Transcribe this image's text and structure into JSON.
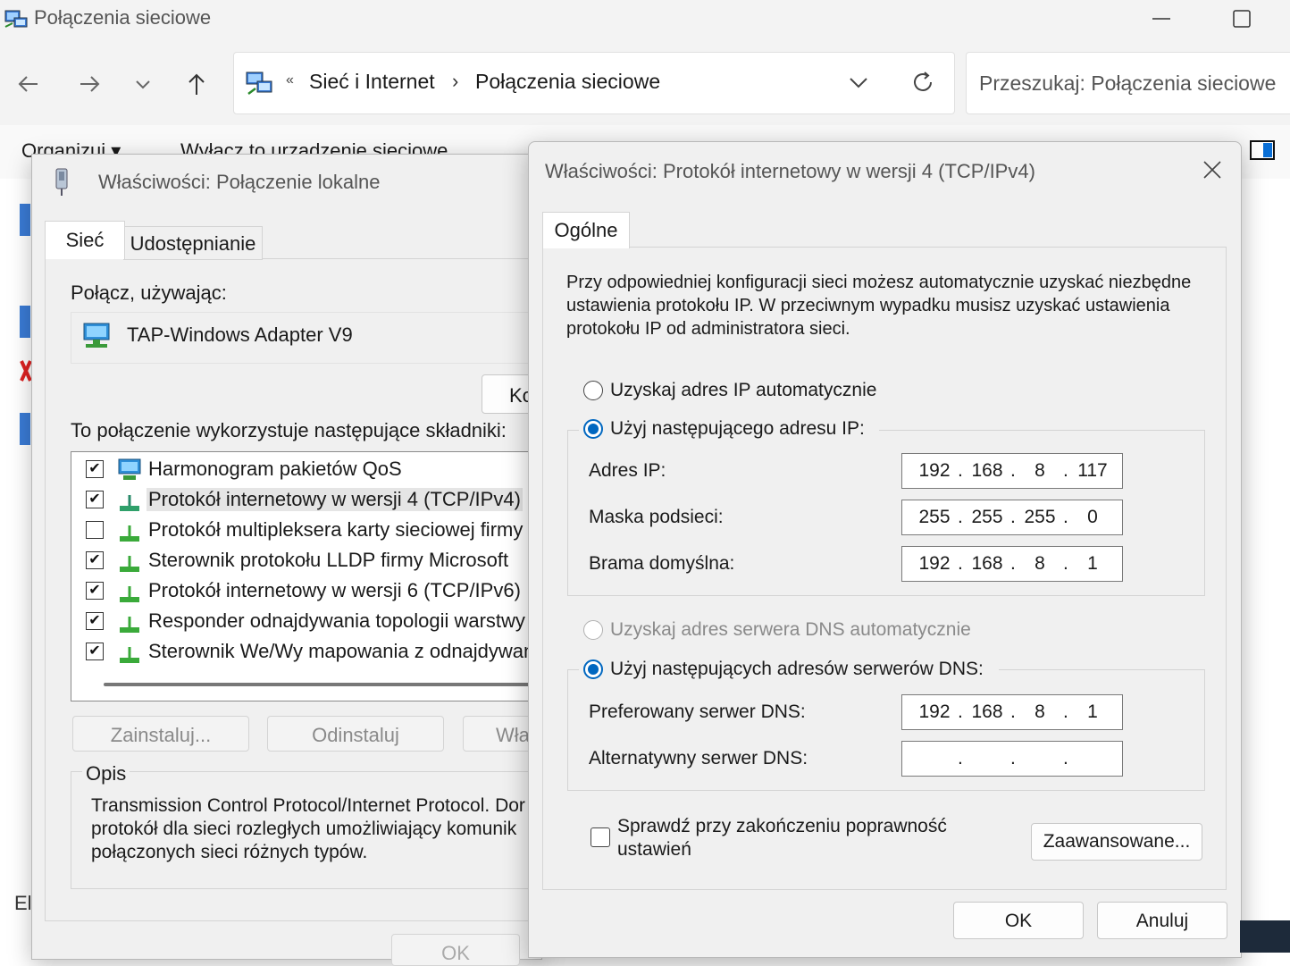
{
  "explorer": {
    "title": "Połączenia sieciowe",
    "breadcrumb_prefix": "«",
    "breadcrumb": [
      "Sieć i Internet",
      "Połączenia sieciowe"
    ],
    "search_placeholder": "Przeszukaj: Połączenia sieciowe",
    "commands": [
      "Organizuj ▾",
      "Wyłącz to urządzenie sieciowe"
    ],
    "bottom_left_text": "El"
  },
  "dialog_local": {
    "title": "Właściwości: Połączenie lokalne",
    "tabs": [
      "Sieć",
      "Udostępnianie"
    ],
    "connect_using_label": "Połącz, używając:",
    "adapter_name": "TAP-Windows Adapter V9",
    "configure_label": "Ko",
    "components_label": "To połączenie wykorzystuje następujące składniki:",
    "components": [
      {
        "label": "Harmonogram pakietów QoS",
        "checked": true,
        "icon": "qos-scheduler-icon"
      },
      {
        "label": "Protokół internetowy w wersji 4 (TCP/IPv4)",
        "checked": true,
        "icon": "protocol-icon"
      },
      {
        "label": "Protokół multipleksera karty sieciowej firmy Mi",
        "checked": false,
        "icon": "protocol-icon"
      },
      {
        "label": "Sterownik protokołu LLDP firmy Microsoft",
        "checked": true,
        "icon": "protocol-icon"
      },
      {
        "label": "Protokół internetowy w wersji 6 (TCP/IPv6)",
        "checked": true,
        "icon": "protocol-icon"
      },
      {
        "label": "Responder odnajdywania topologii warstwy lir",
        "checked": true,
        "icon": "protocol-icon"
      },
      {
        "label": "Sterownik We/Wy mapowania z odnajdywani",
        "checked": true,
        "icon": "protocol-icon"
      }
    ],
    "buttons": {
      "install": "Zainstaluj...",
      "uninstall": "Odinstaluj",
      "properties": "Wła"
    },
    "description_legend": "Opis",
    "description_lines": [
      "Transmission Control Protocol/Internet Protocol. Dor",
      "protokół dla sieci rozległych umożliwiający komunik",
      "połączonych sieci różnych typów."
    ],
    "ok_label": "OK"
  },
  "dialog_ipv4": {
    "title": "Właściwości: Protokół internetowy w wersji 4 (TCP/IPv4)",
    "tab": "Ogólne",
    "intro": "Przy odpowiedniej konfiguracji sieci możesz automatycznie uzyskać niezbędne ustawienia protokołu IP. W przeciwnym wypadku musisz uzyskać ustawienia protokołu IP od administratora sieci.",
    "ip_auto_label": "Uzyskaj adres IP automatycznie",
    "ip_manual_label": "Użyj następującego adresu IP:",
    "ip_mode": "manual",
    "fields": {
      "ip_label": "Adres IP:",
      "ip": [
        "192",
        "168",
        "8",
        "117"
      ],
      "mask_label": "Maska podsieci:",
      "mask": [
        "255",
        "255",
        "255",
        "0"
      ],
      "gateway_label": "Brama domyślna:",
      "gateway": [
        "192",
        "168",
        "8",
        "1"
      ]
    },
    "dns_auto_label": "Uzyskaj adres serwera DNS automatycznie",
    "dns_manual_label": "Użyj następujących adresów serwerów DNS:",
    "dns_mode": "manual",
    "dns": {
      "preferred_label": "Preferowany serwer DNS:",
      "preferred": [
        "192",
        "168",
        "8",
        "1"
      ],
      "alternate_label": "Alternatywny serwer DNS:",
      "alternate": [
        "",
        "",
        "",
        ""
      ]
    },
    "validate_label": "Sprawdź przy zakończeniu poprawność ustawień",
    "validate_checked": false,
    "advanced_label": "Zaawansowane...",
    "ok_label": "OK",
    "cancel_label": "Anuluj"
  }
}
